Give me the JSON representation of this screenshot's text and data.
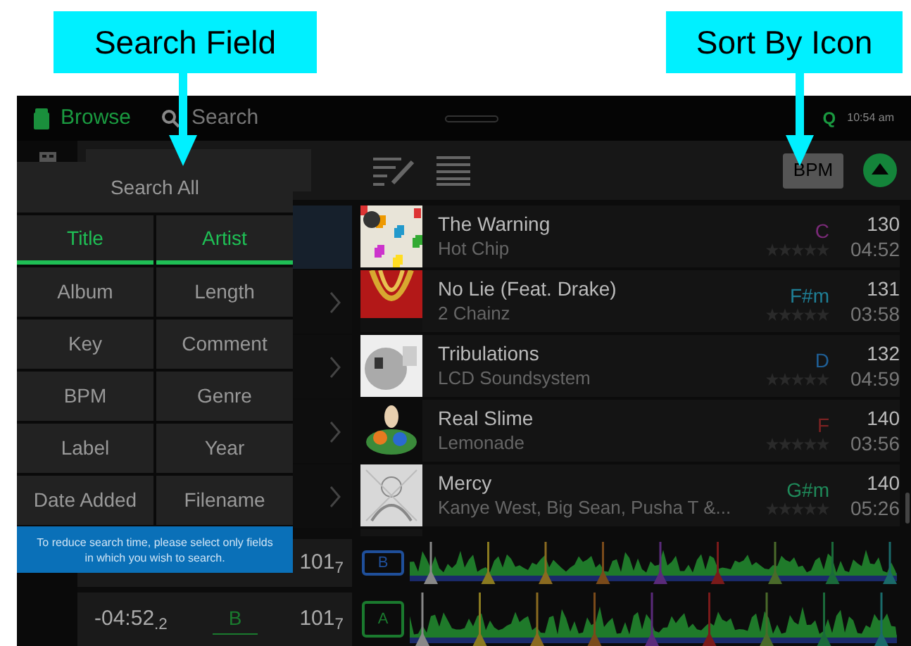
{
  "callouts": [
    {
      "label": "Search Field"
    },
    {
      "label": "Sort By Icon"
    }
  ],
  "top_bar": {
    "browse": "Browse",
    "search": "Search",
    "q": "Q",
    "time": "10:54 am"
  },
  "sort_button": "BPM",
  "crate_rows": [
    {
      "selected": true
    },
    {
      "selected": false
    },
    {
      "selected": false
    },
    {
      "selected": false
    },
    {
      "selected": false
    }
  ],
  "search_menu": {
    "search_all": "Search All",
    "fields": [
      {
        "label": "Title",
        "selected": true
      },
      {
        "label": "Artist",
        "selected": true
      },
      {
        "label": "Album",
        "selected": false
      },
      {
        "label": "Length",
        "selected": false
      },
      {
        "label": "Key",
        "selected": false
      },
      {
        "label": "Comment",
        "selected": false
      },
      {
        "label": "BPM",
        "selected": false
      },
      {
        "label": "Genre",
        "selected": false
      },
      {
        "label": "Label",
        "selected": false
      },
      {
        "label": "Year",
        "selected": false
      },
      {
        "label": "Date Added",
        "selected": false
      },
      {
        "label": "Filename",
        "selected": false
      }
    ],
    "notice": "To reduce search time, please select only fields in which you wish to search."
  },
  "tracks": [
    {
      "title": "The Warning",
      "artist": "Hot Chip",
      "key": "C",
      "color": "#7a2a78",
      "bpm": "130",
      "length": "04:52",
      "stars": 0
    },
    {
      "title": "No Lie (Feat. Drake)",
      "artist": "2 Chainz",
      "key": "F#m",
      "color": "#1f7f96",
      "bpm": "131",
      "length": "03:58",
      "stars": 0
    },
    {
      "title": "Tribulations",
      "artist": "LCD Soundsystem",
      "key": "D",
      "color": "#1f5f96",
      "bpm": "132",
      "length": "04:59",
      "stars": 0
    },
    {
      "title": "Real Slime",
      "artist": "Lemonade",
      "key": "F",
      "color": "#7a2222",
      "bpm": "140",
      "length": "03:56",
      "stars": 0
    },
    {
      "title": "Mercy",
      "artist": "Kanye West, Big Sean, Pusha T &...",
      "key": "G#m",
      "color": "#1f8a5a",
      "bpm": "140",
      "length": "05:26",
      "stars": 0
    }
  ],
  "decks": [
    {
      "badge": "B",
      "color": "#1f4f9a",
      "bpm": "101$_{7}$"
    },
    {
      "badge": "A",
      "color": "#1a7a2e",
      "time": "-04:52$_{.2}$",
      "key": "B",
      "bpm": "101$_{7}$"
    }
  ]
}
